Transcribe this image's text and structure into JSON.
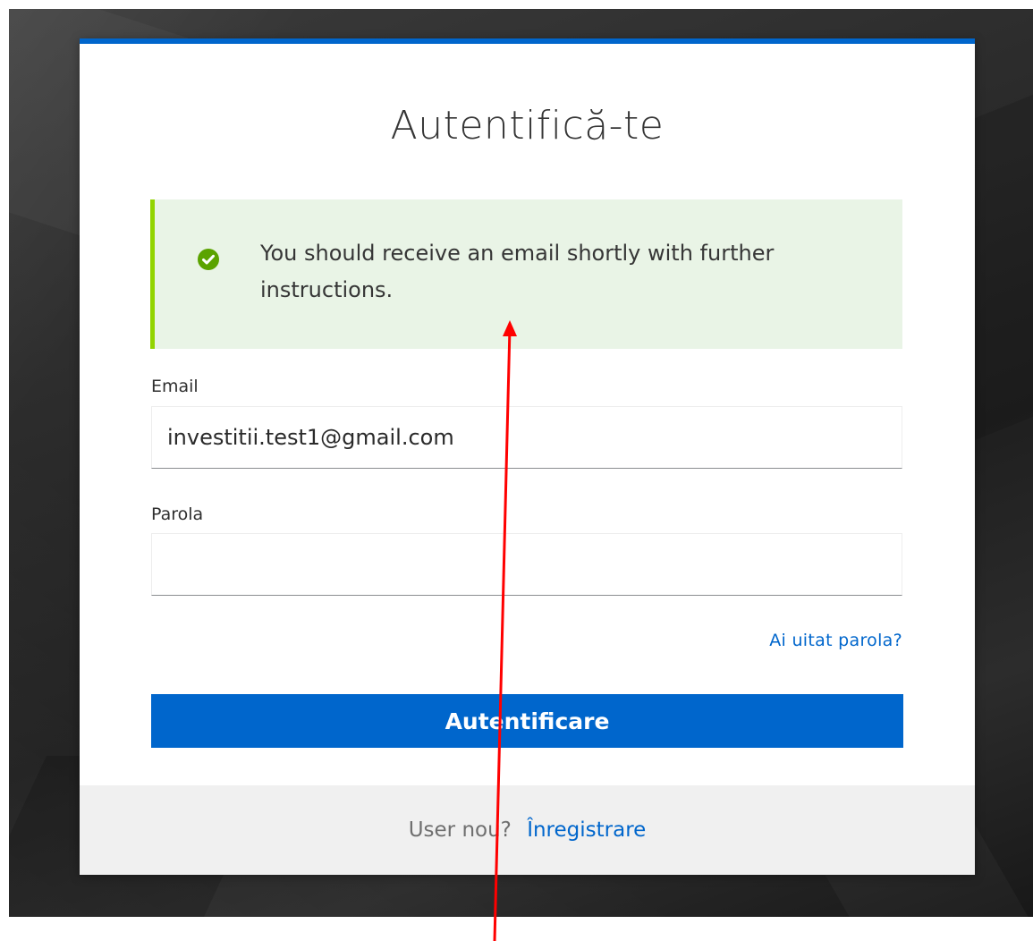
{
  "card": {
    "title": "Autentifică-te",
    "accent_color": "#0066cc"
  },
  "alert": {
    "icon": "check-circle-icon",
    "message": "You should receive an email shortly with further instructions.",
    "accent_color": "#92d400",
    "background_color": "#e9f4e6"
  },
  "form": {
    "email_label": "Email",
    "email_value": "investitii.test1@gmail.com",
    "password_label": "Parola",
    "password_value": "",
    "forgot_password": "Ai uitat parola?",
    "submit_label": "Autentificare"
  },
  "footer": {
    "new_user_text": "User nou?",
    "register_link": "Înregistrare"
  },
  "annotation": {
    "icon": "arrow-up-icon",
    "color": "#ff0000"
  }
}
